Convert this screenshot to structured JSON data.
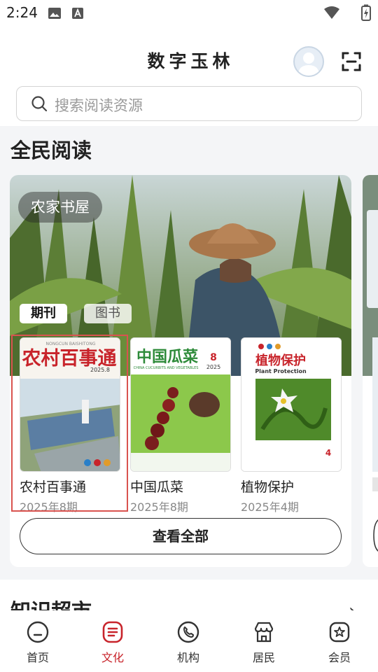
{
  "status_bar": {
    "time": "2:24",
    "icons": [
      "image-icon",
      "text-a-icon",
      "wifi-icon",
      "battery-charging-icon"
    ]
  },
  "header": {
    "app_title": "数字玉林",
    "avatar_icon": "user-avatar-icon",
    "scan_icon": "scan-icon",
    "search_placeholder": "搜索阅读资源"
  },
  "reading": {
    "section_title": "全民阅读",
    "card_badge": "农家书屋",
    "tabs": [
      {
        "label": "期刊",
        "active": true
      },
      {
        "label": "图书",
        "active": false
      }
    ],
    "items": [
      {
        "title": "农村百事通",
        "issue": "2025年8期",
        "cover_masthead": "农村百事通",
        "cover_sub": "NONGCUN BAISHITONG",
        "cover_number": "2025.8"
      },
      {
        "title": "中国瓜菜",
        "issue": "2025年8期",
        "cover_masthead": "中国瓜菜",
        "cover_sub": "CHINA CUCURBITS AND VEGETABLES",
        "cover_number": "8",
        "cover_year": "2025"
      },
      {
        "title": "植物保护",
        "issue": "2025年4期",
        "cover_masthead": "植物保护",
        "cover_sub": "Plant Protection",
        "cover_number": "4"
      }
    ],
    "view_all_label": "查看全部"
  },
  "next_section": {
    "title": "知识超市",
    "chevron": "›"
  },
  "bottom_nav": {
    "items": [
      {
        "label": "首页",
        "icon": "home-face-icon",
        "active": false
      },
      {
        "label": "文化",
        "icon": "culture-list-icon",
        "active": true
      },
      {
        "label": "机构",
        "icon": "phone-icon",
        "active": false
      },
      {
        "label": "居民",
        "icon": "store-icon",
        "active": false
      },
      {
        "label": "会员",
        "icon": "star-badge-icon",
        "active": false
      }
    ]
  },
  "colors": {
    "accent": "#c8242b",
    "background": "#f4f5f7",
    "selection": "#d9534f"
  }
}
